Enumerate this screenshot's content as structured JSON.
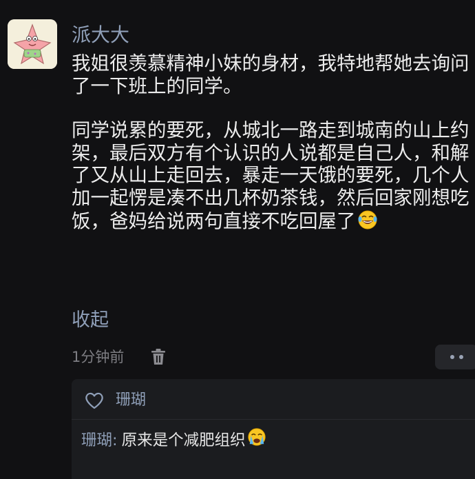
{
  "post": {
    "username": "派大大",
    "paragraph_1": "我姐很羡慕精神小妹的身材，我特地帮她去询问了一下班上的同学。",
    "paragraph_2": "同学说累的要死，从城北一路走到城南的山上约架，最后双方有个认识的人说都是自己人，和解了又从山上走回去，暴走一天饿的要死，几个人加一起愣是凑不出几杯奶茶钱，然后回家刚想吃饭，爸妈给说两句直接不吃回屋了",
    "paragraph_2_emoji": "laughing-crying-emoji",
    "collapse_label": "收起",
    "timestamp": "1分钟前"
  },
  "likes": {
    "liker_name": "珊瑚"
  },
  "reply": {
    "author": "珊瑚",
    "separator": ":",
    "text": "原来是个减肥组织",
    "emoji": "crying-emoji"
  },
  "colors": {
    "background": "#111113",
    "link": "#8f9fb8",
    "text": "#ececec",
    "panel": "#1b1c1f"
  }
}
